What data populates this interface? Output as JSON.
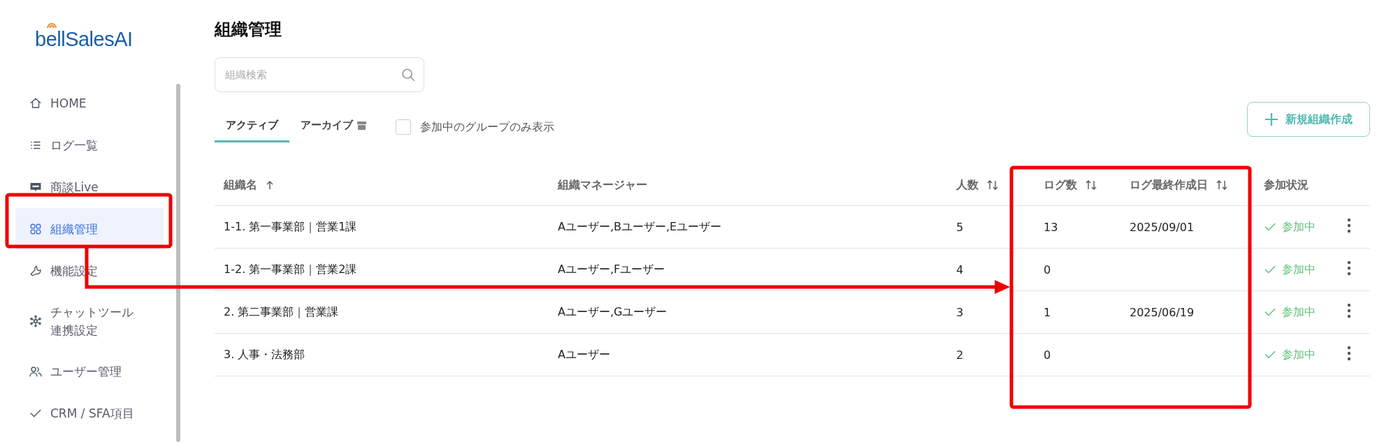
{
  "sidebar": {
    "logo": "bellSalesAI",
    "items": [
      {
        "label": "HOME",
        "selected": false
      },
      {
        "label": "ログ一覧",
        "selected": false
      },
      {
        "label": "商談Live",
        "selected": false
      },
      {
        "label": "組織管理",
        "selected": true
      },
      {
        "label": "機能設定",
        "selected": false
      },
      {
        "label": "チャットツール連携設定",
        "selected": false
      },
      {
        "label": "ユーザー管理",
        "selected": false
      },
      {
        "label": "CRM / SFA項目",
        "selected": false
      }
    ]
  },
  "page": {
    "title": "組織管理",
    "search": {
      "placeholder": "組織検索"
    },
    "tabs": [
      {
        "label": "アクティブ",
        "selected": true
      },
      {
        "label": "アーカイブ",
        "selected": false
      }
    ],
    "filter": {
      "label": "参加中のグループのみ表示",
      "checked": false
    },
    "new_button": "新規組織作成"
  },
  "table": {
    "columns": [
      {
        "label": "組織名",
        "sorted": true
      },
      {
        "label": "組織マネージャー"
      },
      {
        "label": "人数",
        "sorted": false
      },
      {
        "label": "ログ数",
        "sorted": false
      },
      {
        "label": "ログ最終作成日",
        "sorted": false
      },
      {
        "label": "参加状況"
      }
    ],
    "rows": [
      {
        "name": "1-1. 第一事業部｜営業1課",
        "managers": "Aユーザー,Bユーザー,Eユーザー",
        "members": "5",
        "logs": "13",
        "last_created": "2025/09/01",
        "status": "参加中"
      },
      {
        "name": "1-2. 第一事業部｜営業2課",
        "managers": "Aユーザー,Fユーザー",
        "members": "4",
        "logs": "0",
        "status": "参加中"
      },
      {
        "name": "2. 第二事業部｜営業課",
        "managers": "Aユーザー,Gユーザー",
        "members": "3",
        "logs": "1",
        "last_created": "2025/06/19",
        "status": "参加中"
      },
      {
        "name": "3. 人事・法務部",
        "managers": "Aユーザー",
        "members": "2",
        "logs": "0",
        "status": "参加中"
      }
    ]
  },
  "annotations": [
    {
      "kind": "frame"
    },
    {
      "kind": "frame"
    },
    {
      "kind": "arrow"
    }
  ]
}
